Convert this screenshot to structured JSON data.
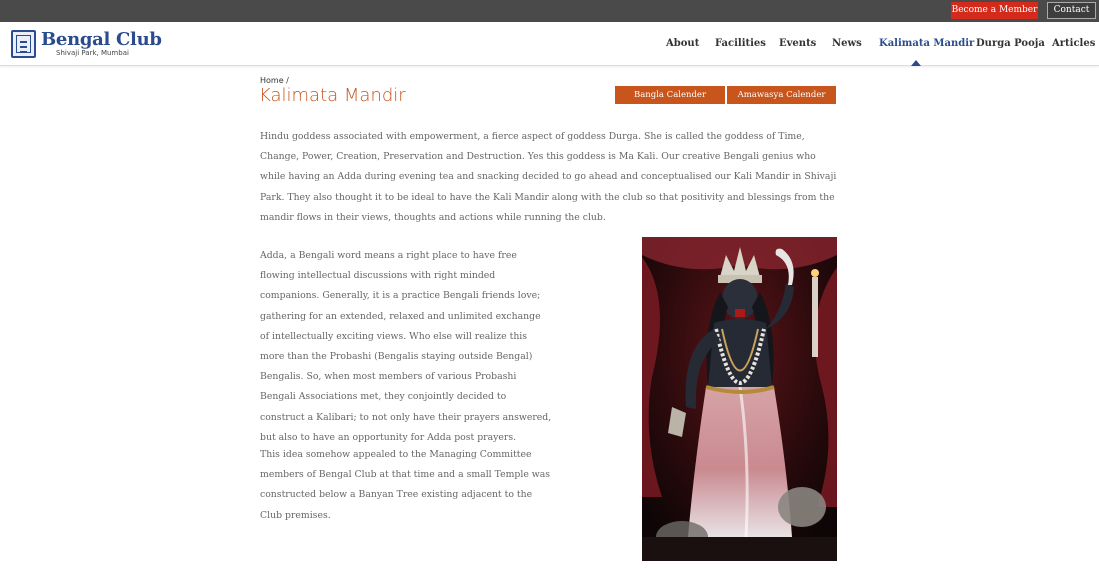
{
  "topbar": {
    "member_label": "Become a Member",
    "contact_label": "Contact"
  },
  "brand": {
    "title": "Bengal Club",
    "subtitle": "Shivaji Park, Mumbai"
  },
  "nav": {
    "items": [
      {
        "label": "About",
        "active": false
      },
      {
        "label": "Facilities",
        "active": false
      },
      {
        "label": "Events",
        "active": false
      },
      {
        "label": "News",
        "active": false
      },
      {
        "label": "Kalimata Mandir",
        "active": true
      },
      {
        "label": "Durga Pooja",
        "active": false
      },
      {
        "label": "Articles",
        "active": false
      }
    ]
  },
  "breadcrumb": {
    "home": "Home",
    "separator": "/"
  },
  "page": {
    "title": "Kalimata Mandir",
    "buttons": {
      "bangla": "Bangla Calender",
      "amawasya": "Amawasya Calender"
    },
    "paragraphs": [
      "Hindu goddess associated with empowerment, a fierce aspect of goddess Durga. She is called the goddess of Time, Change, Power, Creation, Preservation and Destruction. Yes this goddess is Ma Kali.  Our creative Bengali genius who while having an Adda during evening tea and snacking decided to go ahead and conceptualised our Kali Mandir in Shivaji Park.  They also thought it to be ideal to have the Kali Mandir along with the club so that positivity and blessings from the mandir flows in their views, thoughts and actions while running the club.",
      "Adda, a Bengali word means a right place to have free flowing intellectual discussions with right minded companions. Generally, it is a practice Bengali friends love; gathering for an extended, relaxed and unlimited exchange of intellectually exciting views. Who else will realize this more than the Probashi (Bengalis staying outside Bengal) Bengalis. So, when most members of various Probashi Bengali Associations met, they conjointly decided to construct a Kalibari; to not only have their prayers answered, but also to have an opportunity for Adda post prayers.",
      "This idea somehow appealed to the Managing Committee members of Bengal Club at that time and a small Temple was constructed below a Banyan Tree existing adjacent to the Club premises."
    ]
  },
  "colors": {
    "topbar": "#4a4a4a",
    "member_button": "#d32a1c",
    "accent": "#c8551c",
    "brand_blue": "#2b4c8c"
  }
}
